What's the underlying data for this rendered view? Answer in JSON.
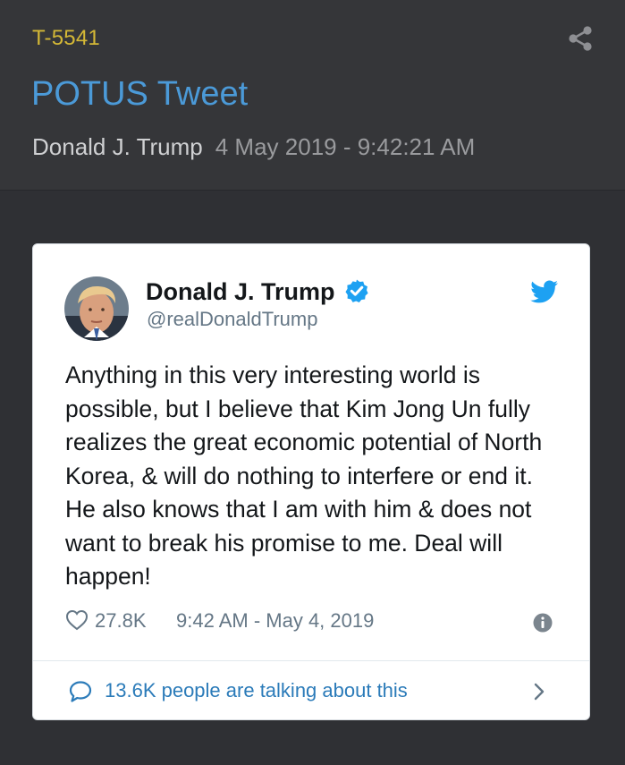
{
  "header": {
    "tweet_id": "T-5541",
    "title": "POTUS Tweet",
    "author": "Donald J. Trump",
    "timestamp": "4 May 2019 - 9:42:21 AM",
    "share_icon": "share-icon"
  },
  "tweet": {
    "display_name": "Donald J. Trump",
    "handle": "@realDonaldTrump",
    "verified_icon": "verified-badge-icon",
    "platform_icon": "twitter-bird-icon",
    "body": "Anything in this very interesting world is possible, but I believe that Kim Jong Un fully realizes the great economic potential of North Korea, & will do nothing to interfere or end it. He also knows that I am with him & does not want to break his promise to me. Deal will happen!",
    "likes": "27.8K",
    "time": "9:42 AM - May 4, 2019",
    "talking": "13.6K people are talking about this"
  },
  "colors": {
    "background": "#2f3034",
    "header_background": "#353639",
    "tweet_id": "#d4b836",
    "title": "#4b9ad8",
    "twitter_blue": "#1da1f2",
    "link": "#2b7bb9"
  }
}
